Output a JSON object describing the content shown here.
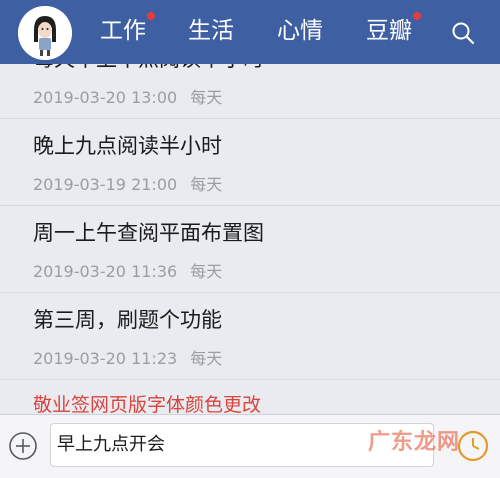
{
  "header": {
    "tabs": [
      {
        "label": "工作",
        "badge": true
      },
      {
        "label": "生活",
        "badge": false
      },
      {
        "label": "心情",
        "badge": false
      },
      {
        "label": "豆瓣",
        "badge": true
      }
    ],
    "background": "#3f5fa3",
    "badge_color": "#e53b3b"
  },
  "list": {
    "items": [
      {
        "title": "每天早上十点阅读半小时",
        "date": "2019-03-20 13:00",
        "repeat": "每天"
      },
      {
        "title": "晚上九点阅读半小时",
        "date": "2019-03-19 21:00",
        "repeat": "每天"
      },
      {
        "title": "周一上午查阅平面布置图",
        "date": "2019-03-20 11:36",
        "repeat": "每天"
      },
      {
        "title": "第三周，刷题个功能",
        "date": "2019-03-20 11:23",
        "repeat": "每天"
      }
    ],
    "notice": "敬业签网页版字体颜色更改",
    "notice_color": "#d9453d"
  },
  "input_bar": {
    "value": "早上九点开会"
  },
  "watermark": "广东龙网",
  "icons": [
    "avatar-icon",
    "search-icon",
    "add-circle-icon",
    "clock-icon"
  ]
}
